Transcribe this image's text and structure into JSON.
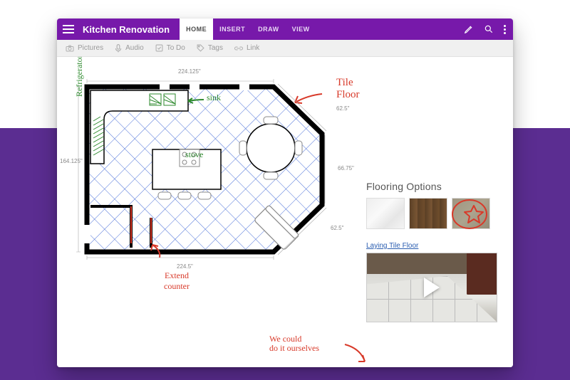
{
  "app": {
    "title": "Kitchen Renovation"
  },
  "tabs": {
    "home": "HOME",
    "insert": "INSERT",
    "draw": "DRAW",
    "view": "VIEW",
    "active": "home"
  },
  "ribbon": {
    "pictures": "Pictures",
    "audio": "Audio",
    "todo": "To Do",
    "tags": "Tags",
    "link": "Link"
  },
  "plan": {
    "dim_top": "224.125\"",
    "dim_left": "164.125\"",
    "dim_right_top": "62.5\"",
    "dim_right_mid": "66.75\"",
    "dim_right_bot": "62.5\"",
    "dim_bottom": "224.5\""
  },
  "annotations": {
    "tile_floor": "Tile\nFloor",
    "refrigerator": "Refrigerator",
    "sink": "sink",
    "stove": "stove",
    "extend_counter": "Extend\ncounter",
    "ourselves": "We could\ndo it ourselves"
  },
  "flooring": {
    "title": "Flooring Options",
    "swatches": [
      "marble",
      "wood",
      "concrete"
    ],
    "selected": "concrete",
    "link": "Laying Tile Floor"
  },
  "icons": {
    "hamburger": "menu-icon",
    "pen": "pen-icon",
    "search": "search-icon",
    "more": "more-icon",
    "camera": "camera-icon",
    "mic": "mic-icon",
    "checkbox": "checkbox-icon",
    "tag": "tag-icon",
    "link": "link-icon",
    "play": "play-icon"
  },
  "colors": {
    "accent": "#7719aa",
    "ink_red": "#d83a2a",
    "ink_green": "#2e8a2e",
    "grid_blue": "#4a6fd8"
  }
}
